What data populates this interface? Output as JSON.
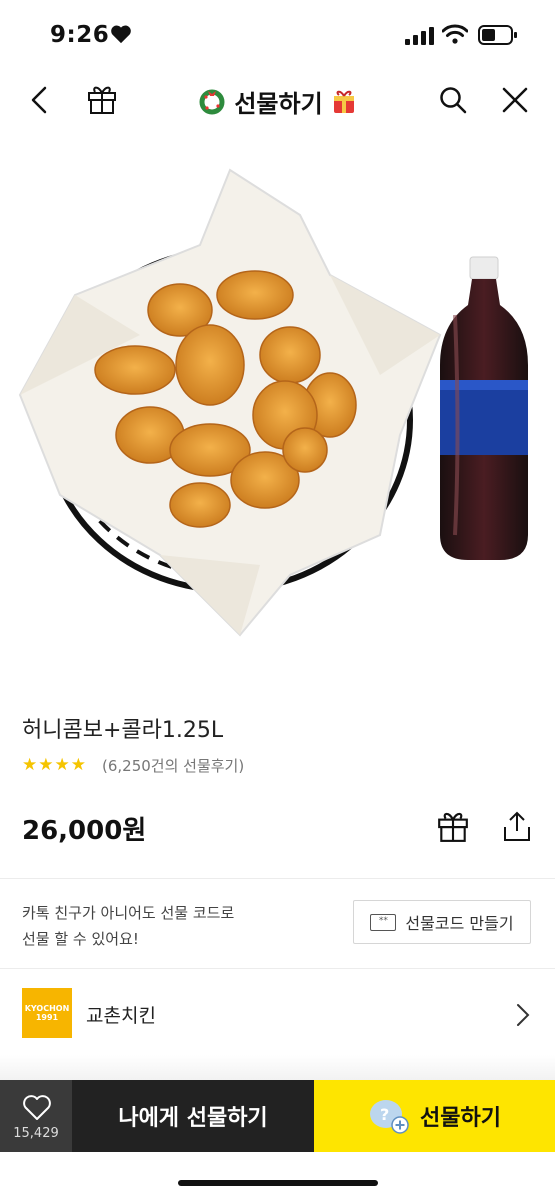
{
  "status_bar": {
    "time": "9:26"
  },
  "nav": {
    "title": "선물하기"
  },
  "product": {
    "name": "허니콤보+콜라1.25L",
    "rating_stars": "★★★★",
    "rating": 4,
    "review_count_text": "(6,250건의 선물후기)",
    "price": "26,000원"
  },
  "promo": {
    "line1": "카톡 친구가 아니어도 선물 코드로",
    "line2": "선물 할 수 있어요!",
    "button_label": "선물코드 만들기",
    "button_icon_text": "**"
  },
  "brand": {
    "logo_line1": "KYOCHON",
    "logo_line2": "1991",
    "name": "교촌치킨"
  },
  "bottom_bar": {
    "like_count": "15,429",
    "self_gift_label": "나에게 선물하기",
    "gift_label": "선물하기",
    "gift_icon_text": "?"
  },
  "colors": {
    "accent_yellow": "#fee500",
    "dark_button": "#222222",
    "like_box": "#3a3a3a",
    "star": "#f5c400",
    "brand_logo": "#f7b500"
  },
  "icons": [
    "heart-icon",
    "signal-icon",
    "wifi-icon",
    "battery-icon",
    "back-icon",
    "gift-icon",
    "wreath-icon",
    "present-icon",
    "search-icon",
    "close-icon",
    "share-icon",
    "chevron-right-icon"
  ]
}
